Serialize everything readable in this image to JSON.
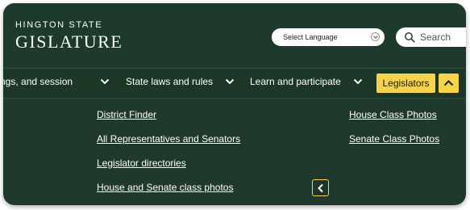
{
  "header": {
    "site_name_top": "HINGTON STATE",
    "site_name_main": "GISLATURE",
    "language_select": {
      "selected": "Select Language"
    },
    "search": {
      "placeholder": "Search"
    }
  },
  "nav": {
    "items": [
      {
        "label": "ngs, and session"
      },
      {
        "label": "State laws and rules"
      },
      {
        "label": "Learn and participate"
      }
    ],
    "active": {
      "label": "Legislators"
    }
  },
  "dropdown": {
    "left_links": [
      "District Finder",
      "All Representatives and Senators",
      "Legislator directories",
      "House and Senate class photos"
    ],
    "right_links": [
      "House Class Photos",
      "Senate Class Photos"
    ]
  },
  "colors": {
    "background": "#1f3a2c",
    "accent": "#f6d44a",
    "text": "#ffffff"
  },
  "icons": {
    "search": "search-icon",
    "chevron": "chevron-down-icon",
    "collapse": "chevron-up-icon",
    "scroll_left": "chevron-left-icon"
  }
}
